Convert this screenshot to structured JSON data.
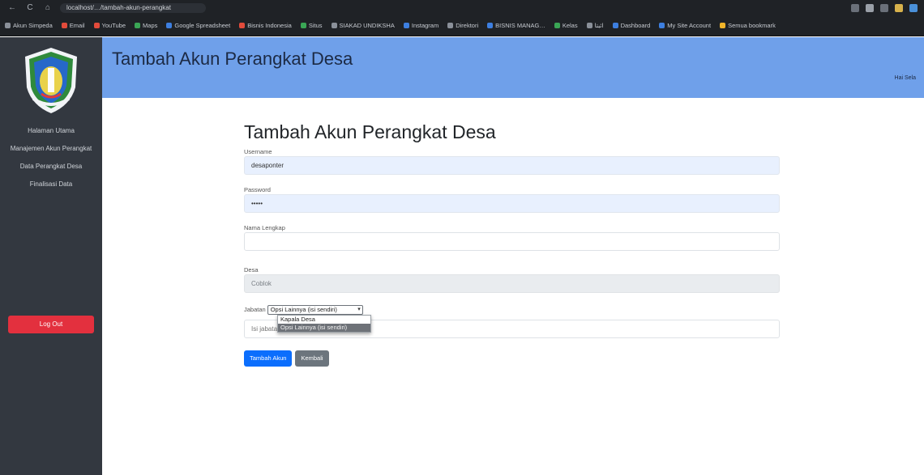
{
  "browser": {
    "nav": [
      "←",
      "C",
      "⌂"
    ],
    "url": "localhost/…/tambah-akun-perangkat",
    "bookmarks": [
      "Akun Simpeda",
      "Email",
      "YouTube",
      "Maps",
      "Google Spreadsheet",
      "Bisnis Indonesia",
      "Situs",
      "SIAKAD UNDIKSHA",
      "Instagram",
      "Direktori",
      "BISNIS MANAG…",
      "Kelas",
      "ائبتا",
      "Dashboard",
      "My Site Account",
      "Semua bookmark"
    ]
  },
  "sidebar": {
    "items": [
      {
        "label": "Halaman Utama"
      },
      {
        "label": "Manajemen Akun Perangkat"
      },
      {
        "label": "Data Perangkat Desa"
      },
      {
        "label": "Finalisasi Data"
      }
    ],
    "logout": "Log Out"
  },
  "header": {
    "title": "Tambah Akun Perangkat Desa",
    "link": "Hai Sela"
  },
  "form": {
    "title": "Tambah Akun Perangkat Desa",
    "username_label": "Username",
    "username_value": "desaponter",
    "password_label": "Password",
    "password_value": "•••••",
    "nama_label": "Nama Lengkap",
    "nama_value": "",
    "desa_label": "Desa",
    "desa_value": "Coblok",
    "jabatan_label": "Jabatan",
    "jabatan_selected": "Opsi Lainnya (isi sendiri)",
    "jabatan_options": [
      "Kapala Desa",
      "Opsi Lainnya (isi sendiri)"
    ],
    "other_placeholder": "Isi jabatan",
    "submit_label": "Tambah Akun",
    "back_label": "Kembali"
  },
  "colors": {
    "header_bg": "#6fa0ea",
    "sidebar_bg": "#333840",
    "logout_bg": "#e3303e",
    "primary": "#0b6efd",
    "secondary": "#6c757d"
  }
}
